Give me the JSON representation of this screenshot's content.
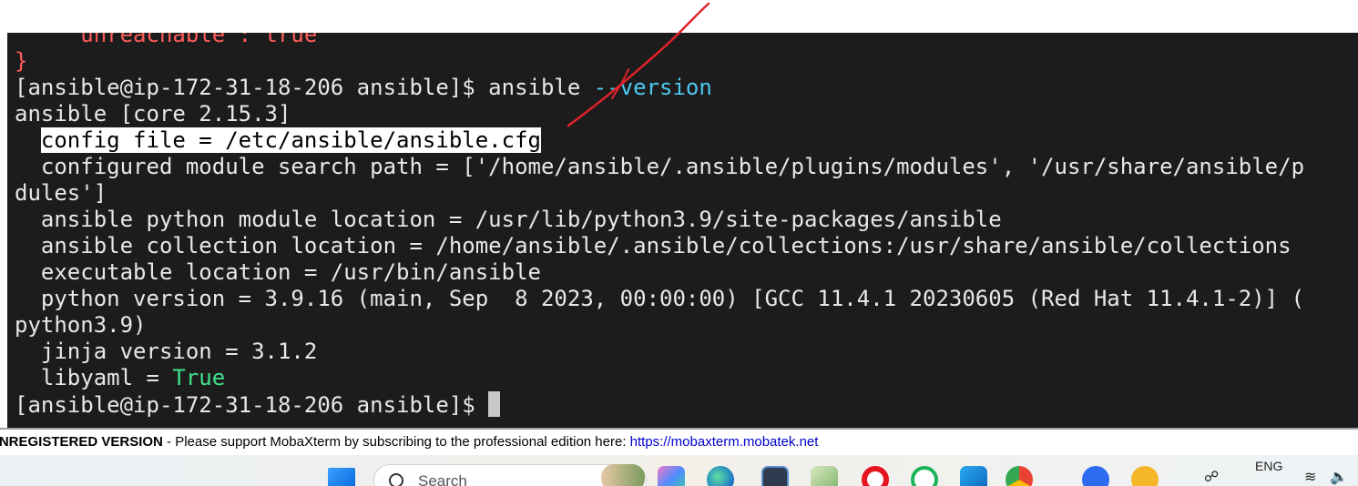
{
  "terminal": {
    "lines": [
      "    \"unreachable\": true",
      "}",
      "[ansible@ip-172-31-18-206 ansible]$ ansible ",
      "ansible [core 2.15.3]",
      "  ",
      "  configured module search path = ['/home/ansible/.ansible/plugins/modules', '/usr/share/ansible/p",
      "dules']",
      "  ansible python module location = /usr/lib/python3.9/site-packages/ansible",
      "  ansible collection location = /home/ansible/.ansible/collections:/usr/share/ansible/collections",
      "  executable location = /usr/bin/ansible",
      "  python version = 3.9.16 (main, Sep  8 2023, 00:00:00) [GCC 11.4.1 20230605 (Red Hat 11.4.1-2)] (",
      "python3.9)",
      "  jinja version = 3.1.2",
      "  libyaml = ",
      "[ansible@ip-172-31-18-206 ansible]$ "
    ],
    "version_flag": "--version",
    "highlighted_config": "config file = /etc/ansible/ansible.cfg",
    "libyaml_value": "True",
    "colors": {
      "background": "#1c1c1c",
      "text": "#e8e8e8",
      "error": "#ff5b5b",
      "flag": "#4ec9f0",
      "bool": "#41e08a",
      "annotation": "#e0222a"
    }
  },
  "banner": {
    "registered": "UNREGISTERED VERSION",
    "message": "  -  Please support MobaXterm by subscribing to the professional edition here:  ",
    "link": "https://mobaxterm.mobatek.net"
  },
  "taskbar": {
    "search_placeholder": "Search",
    "language": "ENG",
    "icons": [
      "windows-start-icon",
      "news-widget-icon",
      "copilot-icon",
      "edge-icon",
      "mobaxterm-icon",
      "notepad-icon",
      "opera-icon",
      "whatsapp-icon",
      "vscode-icon",
      "chrome-icon",
      "zoom-icon",
      "app-icon",
      "microphone-icon",
      "wifi-icon",
      "volume-icon"
    ]
  }
}
